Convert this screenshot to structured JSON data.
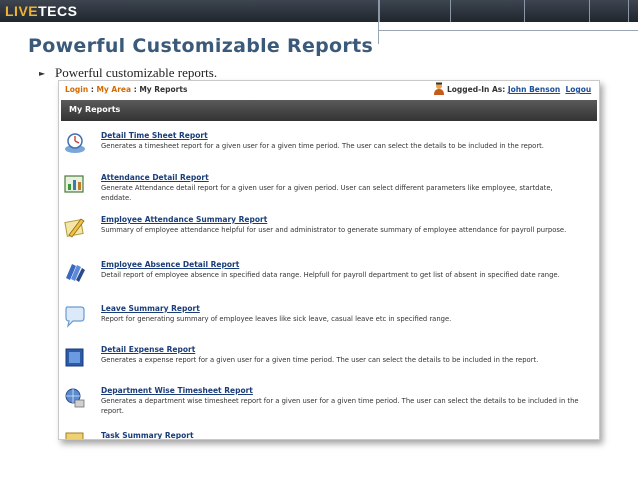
{
  "branding": {
    "logo_live": "LIVE",
    "logo_tecs": "TECS"
  },
  "slide": {
    "title": "Powerful Customizable Reports",
    "bullet_text": "Powerful customizable reports."
  },
  "app": {
    "breadcrumb": {
      "login": "Login",
      "sep1": " : ",
      "my_area": "My Area",
      "sep2": " : ",
      "current": "My Reports"
    },
    "logged_in_label": "Logged-In As: ",
    "user_name": "John Benson",
    "logout": "Logou",
    "section_title": "My Reports",
    "reports": [
      {
        "title": "Detail Time Sheet Report",
        "description": "Generates a timesheet report for a given user for a given time period. The user can select the details to be included in the report.",
        "icon": "clock-icon"
      },
      {
        "title": "Attendance Detail Report",
        "description": "Generate Attendance detail report for a given user for a given period. User can select different parameters like employee, startdate, enddate.",
        "icon": "chart-icon"
      },
      {
        "title": "Employee Attendance Summary Report",
        "description": "Summary of employee attendance helpful for user and administrator to generate summary of employee attendance for payroll purpose.",
        "icon": "pencil-paper-icon"
      },
      {
        "title": "Employee Absence Detail Report",
        "description": "Detail report of employee absence in specified data range. Helpfull for payroll department to get list of absent in specified date range.",
        "icon": "books-icon"
      },
      {
        "title": "Leave Summary Report",
        "description": "Report for generating summary of employee leaves like sick leave, casual leave etc in specified range.",
        "icon": "speech-bubble-icon"
      },
      {
        "title": "Detail Expense Report",
        "description": "Generates a expense report for a given user for a given time period. The user can select the details to be included in the report.",
        "icon": "ledger-icon"
      },
      {
        "title": "Department Wise Timesheet Report",
        "description": "Generates a department wise timesheet report for a given user for a given time period. The user can select the details to be included in the report.",
        "icon": "globe-network-icon"
      },
      {
        "title": "Task Summary Report",
        "description": "",
        "icon": "task-icon"
      }
    ]
  },
  "colors": {
    "topbar": "#2a3038",
    "title": "#3b5a7a",
    "link_orange": "#d46b00",
    "link_blue": "#1a3d7a"
  }
}
